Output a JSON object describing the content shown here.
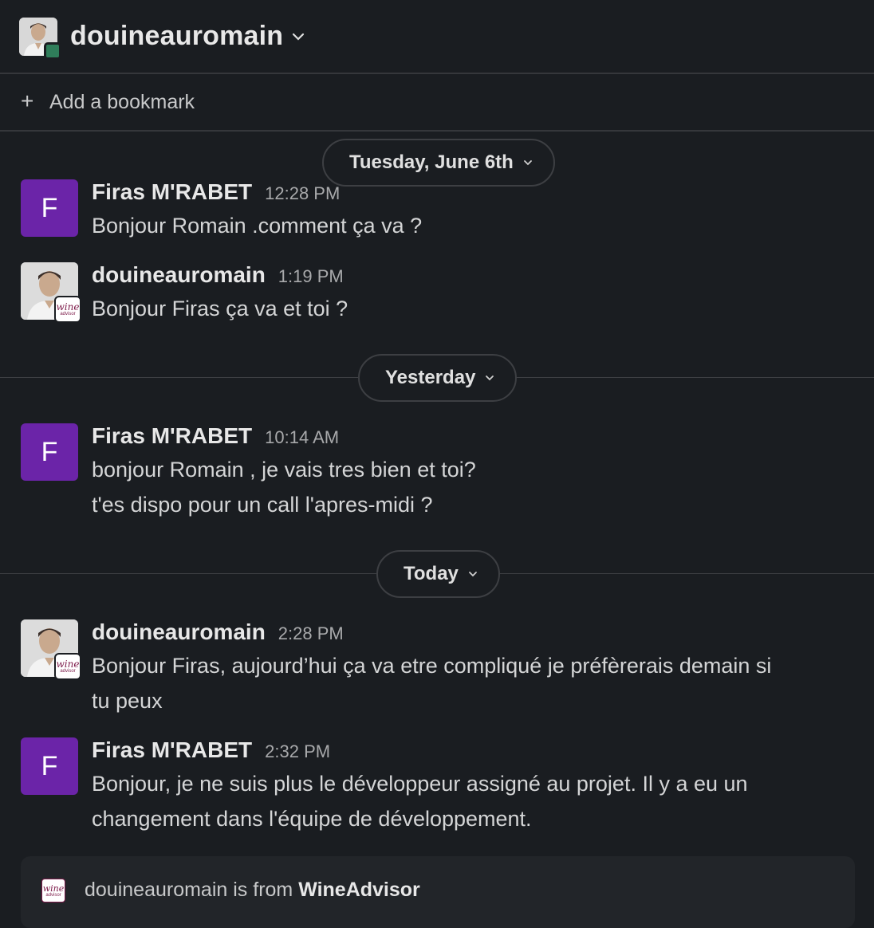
{
  "header": {
    "title": "douineauromain"
  },
  "bookmark": {
    "label": "Add a bookmark"
  },
  "dividers": [
    "Tuesday, June 6th",
    "Yesterday",
    "Today"
  ],
  "messages": [
    {
      "author": "Firas M'RABET",
      "initial": "F",
      "time": "12:28 PM",
      "lines": [
        "Bonjour Romain .comment ça va ?"
      ]
    },
    {
      "author": "douineauromain",
      "time": "1:19 PM",
      "lines": [
        "Bonjour Firas ça va et toi ?"
      ]
    },
    {
      "author": "Firas M'RABET",
      "initial": "F",
      "time": "10:14 AM",
      "lines": [
        "bonjour Romain , je vais tres bien et toi?",
        "t'es dispo pour un call l'apres-midi ?"
      ]
    },
    {
      "author": "douineauromain",
      "time": "2:28 PM",
      "lines": [
        "Bonjour Firas, aujourd’hui ça va etre compliqué je préfèrerais demain si",
        "tu peux"
      ]
    },
    {
      "author": "Firas M'RABET",
      "initial": "F",
      "time": "2:32 PM",
      "lines": [
        "Bonjour, je ne suis plus le développeur assigné au projet. Il y a eu un",
        "changement dans l'équipe de développement."
      ]
    }
  ],
  "org_badge": {
    "word": "wine",
    "sub": "advisor"
  },
  "footer": {
    "prefix": "douineauromain is from",
    "org": "WineAdvisor"
  },
  "colors": {
    "background": "#1a1d21",
    "avatar_purple": "#6b24a8",
    "status_green": "#2f7d5a"
  },
  "icons": [
    "chevron-down-icon",
    "plus-icon"
  ]
}
